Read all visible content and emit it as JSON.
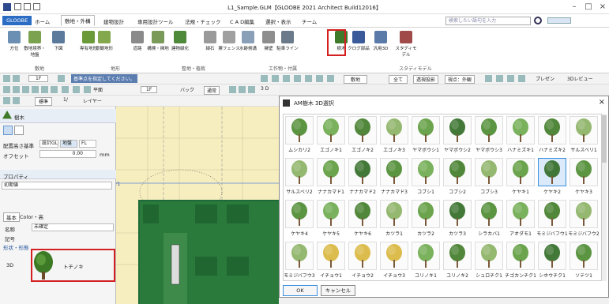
{
  "window": {
    "title": "L1_Sample.GLM【GLOOBE 2021 Architect Build12016】",
    "controls": [
      "–",
      "□",
      "×"
    ]
  },
  "tabs": [
    {
      "label": "GLOOBE",
      "file": true
    },
    {
      "label": "ホーム"
    },
    {
      "label": "敷地・外構",
      "active": true
    },
    {
      "label": "建物設計"
    },
    {
      "label": "専用設計ツール"
    },
    {
      "label": "法規・チェック"
    },
    {
      "label": "C A D編集"
    },
    {
      "label": "選択・表示"
    },
    {
      "label": "チーム"
    }
  ],
  "search": {
    "placeholder": "検索したい語句を入力"
  },
  "ribbon": {
    "buttons": [
      {
        "label": "方位",
        "color": "#6a8fb3"
      },
      {
        "label": "敷地境界・地盤",
        "color": "#7ba34f"
      },
      {
        "label": "下図",
        "color": "#5b7a9c"
      },
      {
        "label": "専有地形",
        "color": "#6b9a3a"
      },
      {
        "label": "景観地形",
        "color": "#84a84e"
      },
      {
        "label": "道路",
        "color": "#8a8a8a"
      },
      {
        "label": "構検・擁地",
        "color": "#7a9a5a"
      },
      {
        "label": "建物緑化",
        "color": "#4f8a3a"
      },
      {
        "label": "緑石",
        "color": "#9a9a9a"
      },
      {
        "label": "塀フェンス",
        "color": "#a0a0a0"
      },
      {
        "label": "水跡側溝",
        "color": "#8aa0b8"
      },
      {
        "label": "擁壁",
        "color": "#8e8e8e"
      },
      {
        "label": "駐車ライン",
        "color": "#6a7a8a"
      },
      {
        "label": "樹木",
        "color": "#3e7a2a"
      },
      {
        "label": "クログ部品",
        "color": "#3a5a9a"
      },
      {
        "label": "汎用3D",
        "color": "#5a7aaa"
      },
      {
        "label": "スタディモデル",
        "color": "#a04a4a"
      }
    ],
    "groups": [
      "敷地",
      "地形",
      "整地・植栽",
      "工作物・付属",
      "スタディモデル"
    ]
  },
  "toolbar": {
    "floor": "1F",
    "prompt": "基準点を指定してください。",
    "floor2": "1F",
    "back": "バック",
    "mode": "通常",
    "view3d": "3 D",
    "layer": "敷地",
    "all": "全て",
    "proj": "透視投影",
    "pt": "視点：外観",
    "present": "プレゼン",
    "review": "3Dレビュー",
    "scale_label": "標準",
    "scale_value": "1/",
    "layer_label": "レイヤー",
    "mini_ribbon": "平面"
  },
  "left_panel": {
    "tool_name": "樹木",
    "height_base_label": "配置高さ基準",
    "height_opts": [
      "設計GL",
      "地盤",
      "FL"
    ],
    "offset_label": "オフセット",
    "offset_value": "0.00",
    "offset_unit": "mm",
    "property_label": "プロパティ",
    "default_label": "初期値",
    "subtabs": [
      "基本",
      "Color・高"
    ],
    "name_label": "名称",
    "name_value": "未確定",
    "sym_label": "記号",
    "shape_label": "形状・形態",
    "three_d_label": "3D",
    "three_d_value": "トチノキ"
  },
  "dialog": {
    "title": "AM樹木 3D選択",
    "ok": "OK",
    "cancel": "キャンセル",
    "rows": [
      [
        "ムシカリ2",
        "エゴノキ1",
        "エゴノキ2",
        "エゴノキ3",
        "ヤマボウシ1",
        "ヤマボウシ2",
        "ヤマボウシ3",
        "ハナミズキ1",
        "ハナミズキ2",
        "サルスベリ1"
      ],
      [
        "サルスベリ2",
        "ナナカマド1",
        "ナナカマド2",
        "ナナカマド3",
        "コブシ1",
        "コブシ2",
        "コブシ3",
        "ケヤキ1",
        "ケヤキ2",
        "ケヤキ3"
      ],
      [
        "ケヤキ4",
        "ケヤキ5",
        "ケヤキ6",
        "カツラ1",
        "カツラ2",
        "カツラ3",
        "シラカバ1",
        "アオダモ1",
        "モミジバフウ1",
        "モミジバフウ2"
      ],
      [
        "モミジバフウ3",
        "イチョウ1",
        "イチョウ2",
        "イチョウ3",
        "ユリノキ1",
        "ユリノキ2",
        "シュロチク1",
        "チゴカンチク1",
        "シホウチク1",
        "ソテツ1"
      ]
    ],
    "selected": "ケヤキ2"
  }
}
